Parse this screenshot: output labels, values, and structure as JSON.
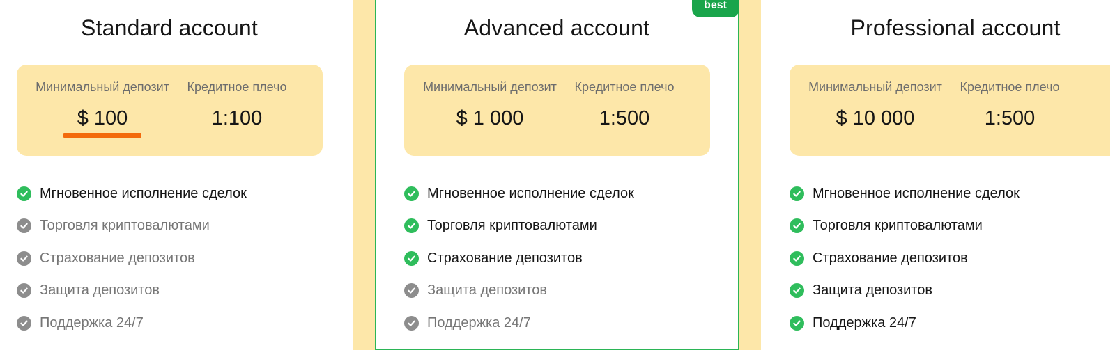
{
  "plans": [
    {
      "title": "Standard account",
      "featured": false,
      "min_deposit_label": "Минимальный депозит",
      "min_deposit_value": "$ 100",
      "leverage_label": "Кредитное плечо",
      "leverage_value": "1:100",
      "features": [
        {
          "label": "Мгновенное исполнение сделок",
          "included": true
        },
        {
          "label": "Торговля криптовалютами",
          "included": false
        },
        {
          "label": "Страхование депозитов",
          "included": false
        },
        {
          "label": "Защита депозитов",
          "included": false
        },
        {
          "label": "Поддержка 24/7",
          "included": false
        }
      ]
    },
    {
      "title": "Advanced account",
      "featured": true,
      "badge": "best",
      "min_deposit_label": "Минимальный депозит",
      "min_deposit_value": "$ 1 000",
      "leverage_label": "Кредитное плечо",
      "leverage_value": "1:500",
      "features": [
        {
          "label": "Мгновенное исполнение сделок",
          "included": true
        },
        {
          "label": "Торговля криптовалютами",
          "included": true
        },
        {
          "label": "Страхование депозитов",
          "included": true
        },
        {
          "label": "Защита депозитов",
          "included": false
        },
        {
          "label": "Поддержка 24/7",
          "included": false
        }
      ]
    },
    {
      "title": "Professional account",
      "featured": false,
      "min_deposit_label": "Минимальный депозит",
      "min_deposit_value": "$ 10 000",
      "leverage_label": "Кредитное плечо",
      "leverage_value": "1:500",
      "features": [
        {
          "label": "Мгновенное исполнение сделок",
          "included": true
        },
        {
          "label": "Торговля криптовалютами",
          "included": true
        },
        {
          "label": "Страхование депозитов",
          "included": true
        },
        {
          "label": "Защита депозитов",
          "included": true
        },
        {
          "label": "Поддержка 24/7",
          "included": true
        }
      ]
    }
  ],
  "colors": {
    "accent_green": "#2fbd5c",
    "badge_green": "#1aa54b",
    "panel_yellow": "#fde7a9",
    "highlight_orange": "#f36a0c",
    "muted_gray": "#8d8d8d"
  }
}
